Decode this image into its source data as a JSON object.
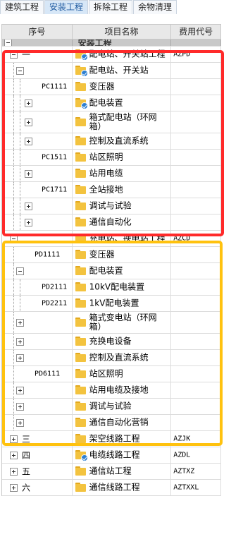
{
  "tabs": [
    "建筑工程",
    "安装工程",
    "拆除工程",
    "余物清理"
  ],
  "active_tab": "安装工程",
  "columns": {
    "seq": "序号",
    "name": "项目名称",
    "fee_code": "费用代号"
  },
  "section_title": "安装工程",
  "rows": [
    {
      "seq": "一",
      "name": "配电站、开关站工程",
      "fee": "AZPD"
    },
    {
      "seq": "",
      "name": "配电站、开关站",
      "fee": ""
    },
    {
      "seq": "PC1111",
      "name": "变压器",
      "fee": ""
    },
    {
      "seq": "",
      "name": "配电装置",
      "fee": ""
    },
    {
      "seq": "",
      "name": "箱式配电站（环网箱）",
      "fee": ""
    },
    {
      "seq": "",
      "name": "控制及直流系统",
      "fee": ""
    },
    {
      "seq": "PC1511",
      "name": "站区照明",
      "fee": ""
    },
    {
      "seq": "",
      "name": "站用电缆",
      "fee": ""
    },
    {
      "seq": "PC1711",
      "name": "全站接地",
      "fee": ""
    },
    {
      "seq": "",
      "name": "调试与试验",
      "fee": ""
    },
    {
      "seq": "",
      "name": "通信自动化",
      "fee": ""
    },
    {
      "seq": "二",
      "name": "充电站、换电站工程",
      "fee": "AZCD"
    },
    {
      "seq": "PD1111",
      "name": "变压器",
      "fee": ""
    },
    {
      "seq": "",
      "name": "配电装置",
      "fee": ""
    },
    {
      "seq": "PD2111",
      "name": "10kV配电装置",
      "fee": ""
    },
    {
      "seq": "PD2211",
      "name": "1kV配电装置",
      "fee": ""
    },
    {
      "seq": "",
      "name": "箱式变电站（环网箱）",
      "fee": ""
    },
    {
      "seq": "",
      "name": "充换电设备",
      "fee": ""
    },
    {
      "seq": "",
      "name": "控制及直流系统",
      "fee": ""
    },
    {
      "seq": "PD6111",
      "name": "站区照明",
      "fee": ""
    },
    {
      "seq": "",
      "name": "站用电缆及接地",
      "fee": ""
    },
    {
      "seq": "",
      "name": "调试与试验",
      "fee": ""
    },
    {
      "seq": "",
      "name": "通信自动化营销",
      "fee": ""
    },
    {
      "seq": "三",
      "name": "架空线路工程",
      "fee": "AZJK"
    },
    {
      "seq": "四",
      "name": "电缆线路工程",
      "fee": "AZDL"
    },
    {
      "seq": "五",
      "name": "通信站工程",
      "fee": "AZTXZ"
    },
    {
      "seq": "六",
      "name": "通信线路工程",
      "fee": "AZTXXL"
    }
  ],
  "highlight_colors": {
    "red": "#ff2a2a",
    "yellow": "#ffc20e"
  },
  "icons": {
    "folder": "folder-icon",
    "checked_folder": "folder-check-icon",
    "expander": "tree-expander-icon"
  }
}
